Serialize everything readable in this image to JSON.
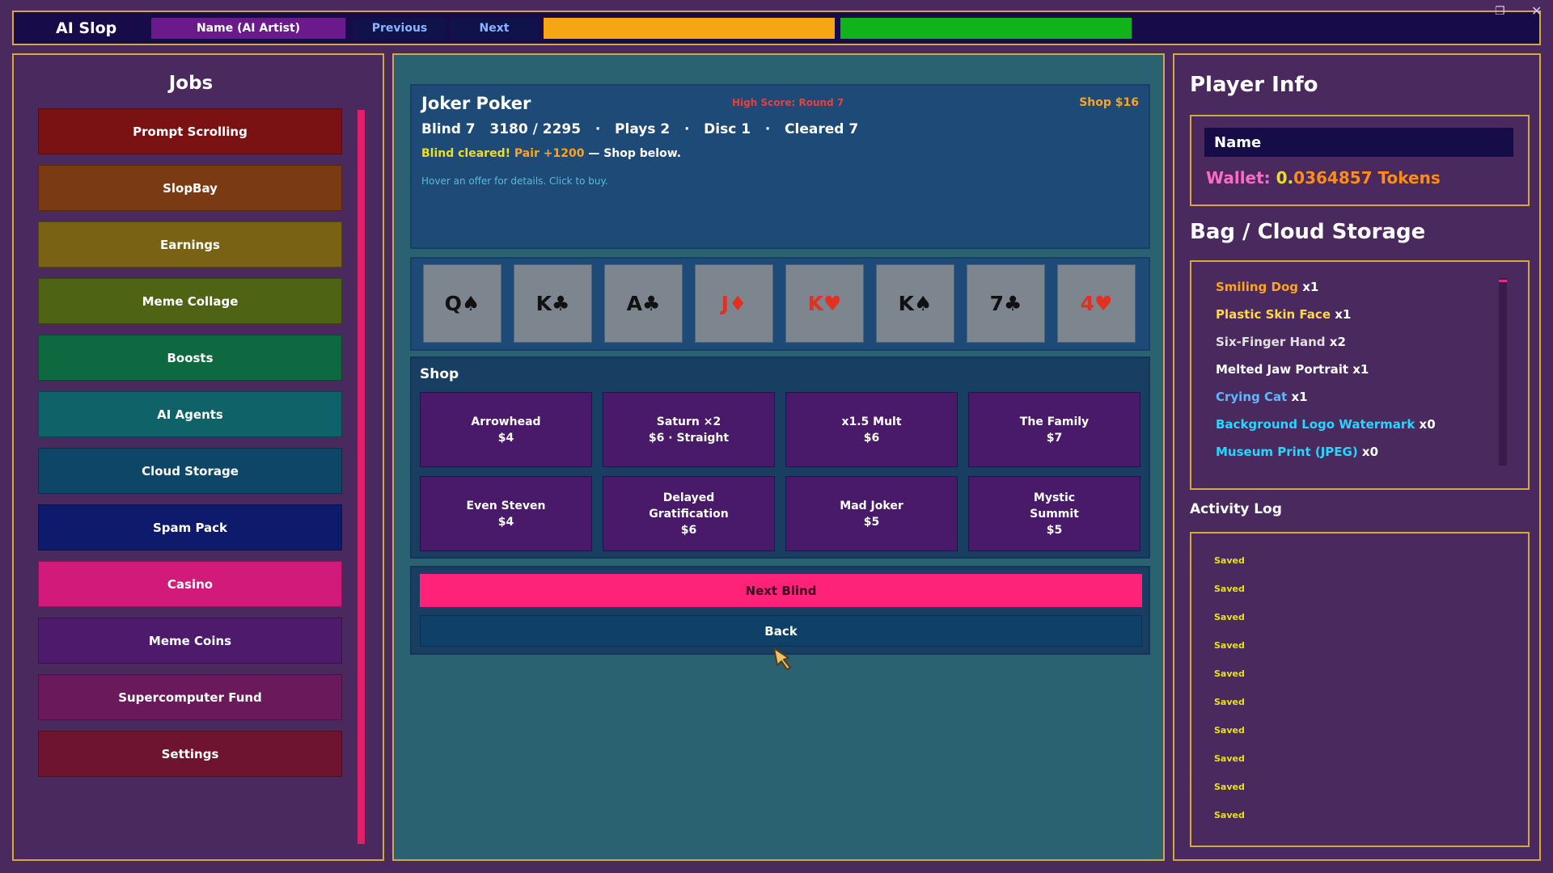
{
  "topbar": {
    "title": "AI Slop",
    "name_button": "Name (AI Artist)",
    "previous": "Previous",
    "next": "Next"
  },
  "jobs": {
    "title": "Jobs",
    "items": [
      {
        "label": "Prompt Scrolling",
        "color": "#7a1214"
      },
      {
        "label": "SlopBay",
        "color": "#7a3a14"
      },
      {
        "label": "Earnings",
        "color": "#7a6214"
      },
      {
        "label": "Meme Collage",
        "color": "#4e6414"
      },
      {
        "label": "Boosts",
        "color": "#0e6840"
      },
      {
        "label": "AI Agents",
        "color": "#0e6268"
      },
      {
        "label": "Cloud Storage",
        "color": "#0e4668"
      },
      {
        "label": "Spam Pack",
        "color": "#0e1a6c"
      },
      {
        "label": "Casino",
        "color": "#d21a7a"
      },
      {
        "label": "Meme Coins",
        "color": "#4e1a6c"
      },
      {
        "label": "Supercomputer Fund",
        "color": "#6a1a5a"
      },
      {
        "label": "Settings",
        "color": "#6e1430"
      }
    ]
  },
  "game": {
    "title": "Joker Poker",
    "high_score": "High Score: Round 7",
    "shop_money": "Shop $16",
    "stats": "Blind 7   3180 / 2295   ·   Plays 2   ·   Disc 1   ·   Cleared 7",
    "status_cleared": "Blind cleared!",
    "status_pair": "Pair +1200",
    "status_rest": " — Shop below.",
    "hint": "Hover an offer for details. Click to buy.",
    "hand": [
      {
        "label": "Q♠",
        "suit_color": "black"
      },
      {
        "label": "K♣",
        "suit_color": "black"
      },
      {
        "label": "A♣",
        "suit_color": "black"
      },
      {
        "label": "J♦",
        "suit_color": "red"
      },
      {
        "label": "K♥",
        "suit_color": "red"
      },
      {
        "label": "K♠",
        "suit_color": "black"
      },
      {
        "label": "7♣",
        "suit_color": "black"
      },
      {
        "label": "4♥",
        "suit_color": "red"
      }
    ],
    "shop_title": "Shop",
    "offers": [
      "Arrowhead\n$4",
      "Saturn ×2\n$6 · Straight",
      "x1.5 Mult\n$6",
      "The Family\n$7",
      "Even Steven\n$4",
      "Delayed\nGratification\n$6",
      "Mad Joker\n$5",
      "Mystic\nSummit\n$5"
    ],
    "next_blind": "Next Blind",
    "back": "Back"
  },
  "player": {
    "title": "Player Info",
    "name": "Name",
    "wallet_label": "Wallet: ",
    "wallet_zero": "0.",
    "wallet_value": "0364857 Tokens"
  },
  "bag": {
    "title": "Bag / Cloud Storage",
    "items": [
      {
        "name": "Smiling Dog",
        "count": " x1",
        "color": "#ffa31a"
      },
      {
        "name": "Plastic Skin Face",
        "count": " x1",
        "color": "#ffd84a"
      },
      {
        "name": "Six-Finger Hand",
        "count": " x2",
        "color": "#e0e0e0"
      },
      {
        "name": "Melted Jaw Portrait",
        "count": " x1",
        "color": "#ffffff"
      },
      {
        "name": "Crying Cat",
        "count": " x1",
        "color": "#5eb7ff"
      },
      {
        "name": "Background Logo Watermark",
        "count": " x0",
        "color": "#22d8ff"
      },
      {
        "name": "Museum Print (JPEG)",
        "count": " x0",
        "color": "#22d8ff"
      }
    ]
  },
  "log": {
    "title": "Activity Log",
    "entries": [
      "Saved",
      "Saved",
      "Saved",
      "Saved",
      "Saved",
      "Saved",
      "Saved",
      "Saved",
      "Saved",
      "Saved"
    ]
  }
}
